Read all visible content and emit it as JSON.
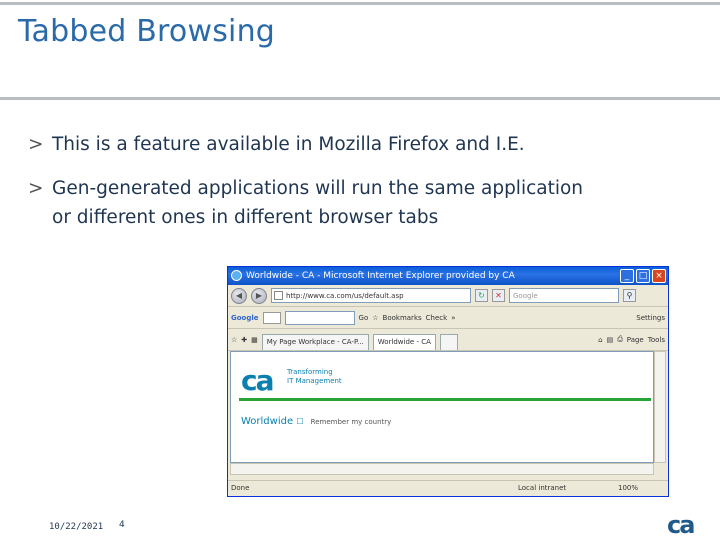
{
  "slide": {
    "title": "Tabbed Browsing",
    "bullets": [
      {
        "mark": ">",
        "lines": [
          "This is a feature available in Mozilla Firefox and I.E."
        ]
      },
      {
        "mark": ">",
        "lines": [
          "Gen-generated applications will run the same application",
          "or different ones in different browser tabs"
        ]
      }
    ],
    "footer": {
      "date": "10/22/2021",
      "page": "4",
      "logo": "ca"
    }
  },
  "browser": {
    "window_title": "Worldwide - CA - Microsoft Internet Explorer provided by CA",
    "address": "http://www.ca.com/us/default.asp",
    "search_placeholder": "Google",
    "google_label": "Google",
    "google_toolbar": [
      "Go",
      "Bookmarks",
      "Check",
      "Settings"
    ],
    "tabs": [
      {
        "label": "My Page Workplace - CA-P...",
        "active": false
      },
      {
        "label": "Worldwide - CA",
        "active": true
      }
    ],
    "command_bar": [
      "Page",
      "Tools"
    ],
    "page": {
      "logo": "ca",
      "tagline": [
        "Transforming",
        "IT Management"
      ],
      "region_label": "Worldwide",
      "remember": "Remember my country"
    },
    "status": {
      "text": "Done",
      "zone": "Local intranet",
      "zoom": "100%"
    }
  }
}
